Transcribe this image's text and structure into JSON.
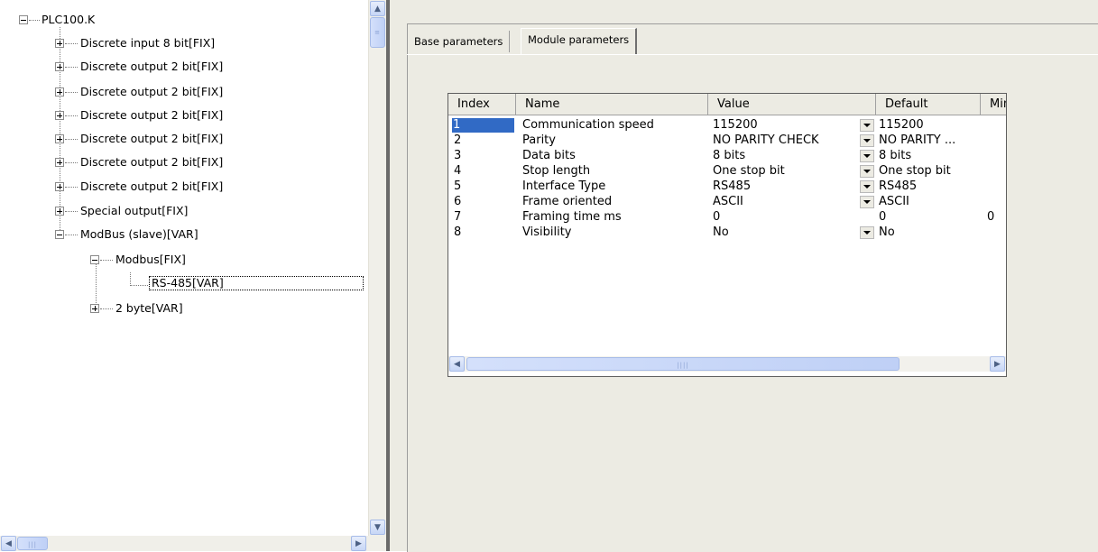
{
  "tree": {
    "root": "PLC100.K",
    "items": [
      {
        "label": "Discrete input 8 bit[FIX]",
        "state": "plus"
      },
      {
        "label": "Discrete output 2 bit[FIX]",
        "state": "plus"
      },
      {
        "label": "Discrete output 2 bit[FIX]",
        "state": "plus"
      },
      {
        "label": "Discrete output 2 bit[FIX]",
        "state": "plus"
      },
      {
        "label": "Discrete output 2 bit[FIX]",
        "state": "plus"
      },
      {
        "label": "Discrete output 2 bit[FIX]",
        "state": "plus"
      },
      {
        "label": "Discrete output 2 bit[FIX]",
        "state": "plus"
      },
      {
        "label": "Special output[FIX]",
        "state": "plus"
      },
      {
        "label": "ModBus (slave)[VAR]",
        "state": "minus"
      }
    ],
    "modbus_child": "Modbus[FIX]",
    "selected_leaf": "RS-485[VAR]",
    "byte_child": "2 byte[VAR]"
  },
  "tabs": {
    "base": "Base parameters",
    "module": "Module parameters",
    "active": "module"
  },
  "grid": {
    "columns": [
      "Index",
      "Name",
      "Value",
      "Default",
      "Min"
    ],
    "rows": [
      {
        "index": "1",
        "name": "Communication speed",
        "value": "115200",
        "default": "115200",
        "min": ""
      },
      {
        "index": "2",
        "name": "Parity",
        "value": "NO PARITY CHECK",
        "default": "NO PARITY ...",
        "min": ""
      },
      {
        "index": "3",
        "name": "Data bits",
        "value": "8 bits",
        "default": "8 bits",
        "min": ""
      },
      {
        "index": "4",
        "name": "Stop length",
        "value": "One stop bit",
        "default": "One stop bit",
        "min": ""
      },
      {
        "index": "5",
        "name": "Interface Type",
        "value": "RS485",
        "default": "RS485",
        "min": ""
      },
      {
        "index": "6",
        "name": "Frame oriented",
        "value": "ASCII",
        "default": "ASCII",
        "min": ""
      },
      {
        "index": "7",
        "name": "Framing time ms",
        "value": "0",
        "default": "0",
        "min": "0"
      },
      {
        "index": "8",
        "name": "Visibility",
        "value": "No",
        "default": "No",
        "min": ""
      }
    ],
    "selected_row": 1
  }
}
